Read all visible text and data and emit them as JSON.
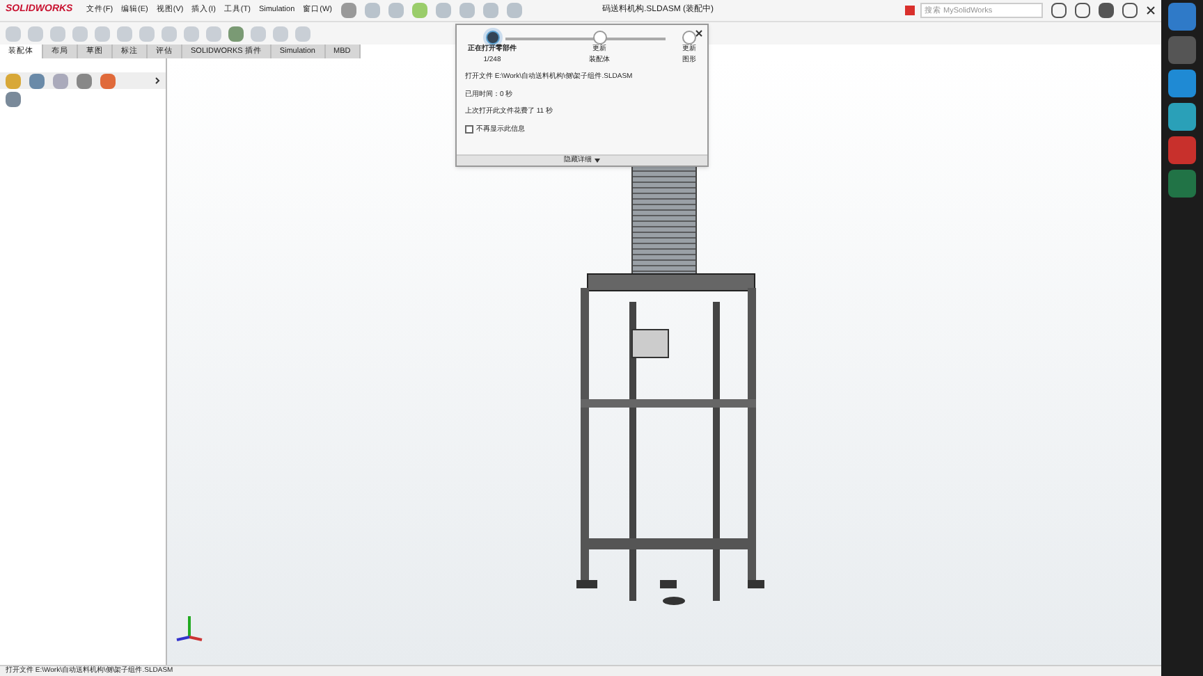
{
  "app": {
    "logo": "SOLIDWORKS",
    "title": "码送料机构.SLDASM (装配中)",
    "search": {
      "placeholder": "搜索 MySolidWorks"
    }
  },
  "menu": [
    "文件(F)",
    "编辑(E)",
    "视图(V)",
    "插入(I)",
    "工具(T)",
    "Simulation",
    "窗口(W)"
  ],
  "tabs": [
    {
      "label": "装配体",
      "selected": true
    },
    {
      "label": "布局",
      "selected": false
    },
    {
      "label": "草图",
      "selected": false
    },
    {
      "label": "标注",
      "selected": false
    },
    {
      "label": "评估",
      "selected": false
    },
    {
      "label": "SOLIDWORKS 插件",
      "selected": false
    },
    {
      "label": "Simulation",
      "selected": false
    },
    {
      "label": "MBD",
      "selected": false
    }
  ],
  "progress_dialog": {
    "steps": [
      {
        "label": "正在打开零部件",
        "sub": "1/248",
        "selected": true
      },
      {
        "label": "更新",
        "sub": "装配体",
        "selected": false
      },
      {
        "label": "更新",
        "sub": "图形",
        "selected": false
      }
    ],
    "file": "打开文件 E:\\Work\\自动送料机构\\侧\\架子组件.SLDASM",
    "elapsed": "已用时间：0 秒",
    "last_time": "上次打开此文件花费了 11 秒",
    "dont_show": {
      "label": "不再显示此信息",
      "checked": false
    },
    "details": "隐藏详细"
  },
  "status_bar": "打开文件 E:\\Work\\自动送料机构\\侧\\架子组件.SLDASM"
}
